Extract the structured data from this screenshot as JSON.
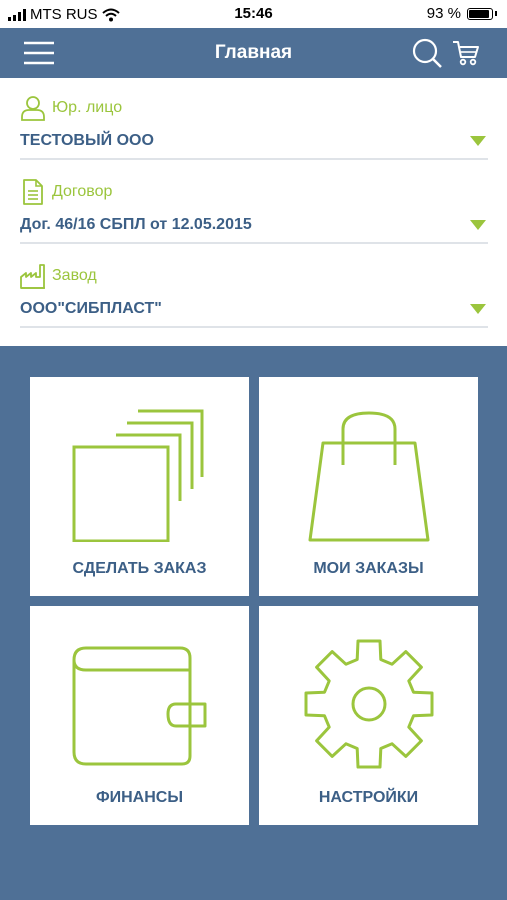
{
  "status_bar": {
    "carrier": "MTS RUS",
    "time": "15:46",
    "battery_percent": "93 %",
    "battery_level": 0.93
  },
  "nav": {
    "title": "Главная",
    "icons": [
      "menu-icon",
      "search-icon",
      "cart-icon"
    ]
  },
  "selectors": [
    {
      "label": "Юр. лицо",
      "value": "ТЕСТОВЫЙ ООО",
      "icon": "person-icon"
    },
    {
      "label": "Договор",
      "value": "Дог. 46/16 СБПЛ от 12.05.2015",
      "icon": "document-icon"
    },
    {
      "label": "Завод",
      "value": "ООО\"СИБПЛАСТ\"",
      "icon": "factory-icon"
    }
  ],
  "tiles": [
    {
      "label": "СДЕЛАТЬ ЗАКАЗ",
      "icon": "stacked-pages-icon"
    },
    {
      "label": "МОИ ЗАКАЗЫ",
      "icon": "shopping-bag-icon"
    },
    {
      "label": "ФИНАНСЫ",
      "icon": "wallet-icon"
    },
    {
      "label": "НАСТРОЙКИ",
      "icon": "gear-icon"
    }
  ],
  "colors": {
    "primary": "#4f7096",
    "accent_green": "#9bc53d",
    "text_blue": "#3c5f86",
    "background": "#ffffff"
  }
}
